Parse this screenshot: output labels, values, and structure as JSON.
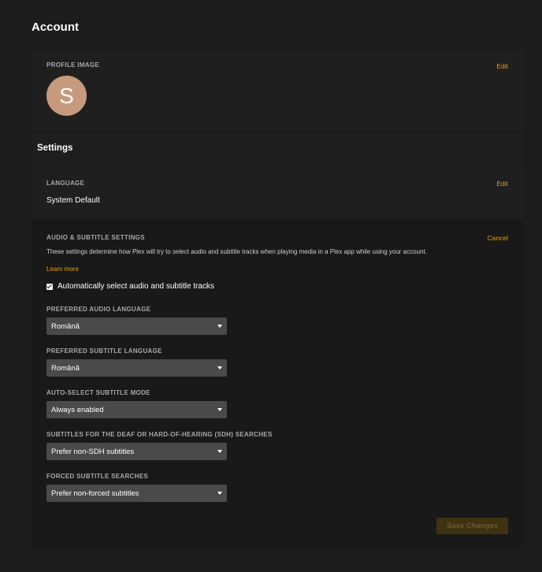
{
  "page": {
    "title": "Account"
  },
  "profile": {
    "label": "Profile Image",
    "edit_label": "Edit",
    "avatar_initial": "S",
    "avatar_color": "#c79a7d"
  },
  "settings": {
    "title": "Settings"
  },
  "language": {
    "label": "Language",
    "edit_label": "Edit",
    "value": "System Default"
  },
  "audio_subtitle": {
    "label": "Audio & Subtitle Settings",
    "cancel_label": "Cancel",
    "description": "These settings determine how Plex will try to select audio and subtitle tracks when playing media in a Plex app while using your account.",
    "learn_more": "Learn more",
    "auto_select": {
      "label": "Automatically select audio and subtitle tracks",
      "checked": true
    },
    "fields": [
      {
        "label": "Preferred Audio Language",
        "value": "Română"
      },
      {
        "label": "Preferred Subtitle Language",
        "value": "Română"
      },
      {
        "label": "Auto-Select Subtitle Mode",
        "value": "Always enabled"
      },
      {
        "label": "Subtitles for the Deaf or Hard-of-Hearing (SDH) Searches",
        "value": "Prefer non-SDH subtitles"
      },
      {
        "label": "Forced Subtitle Searches",
        "value": "Prefer non-forced subtitles"
      }
    ],
    "save_label": "Save Changes"
  },
  "colors": {
    "accent": "#e5a00d",
    "background": "#1c1c1c",
    "select_background": "#4a4a4a"
  }
}
